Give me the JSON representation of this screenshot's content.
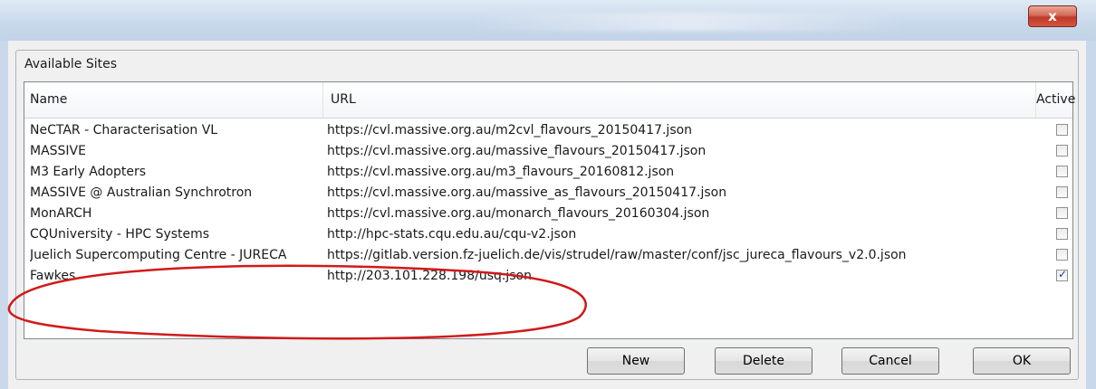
{
  "window": {
    "close_glyph": "x"
  },
  "group": {
    "title": "Available Sites"
  },
  "table": {
    "columns": [
      "Name",
      "URL",
      "Active"
    ],
    "rows": [
      {
        "name": "NeCTAR - Characterisation VL",
        "url": "https://cvl.massive.org.au/m2cvl_flavours_20150417.json",
        "active": false
      },
      {
        "name": "MASSIVE",
        "url": "https://cvl.massive.org.au/massive_flavours_20150417.json",
        "active": false
      },
      {
        "name": "M3 Early Adopters",
        "url": "https://cvl.massive.org.au/m3_flavours_20160812.json",
        "active": false
      },
      {
        "name": "MASSIVE @ Australian Synchrotron",
        "url": "https://cvl.massive.org.au/massive_as_flavours_20150417.json",
        "active": false
      },
      {
        "name": "MonARCH",
        "url": "https://cvl.massive.org.au/monarch_flavours_20160304.json",
        "active": false
      },
      {
        "name": "CQUniversity - HPC Systems",
        "url": "http://hpc-stats.cqu.edu.au/cqu-v2.json",
        "active": false
      },
      {
        "name": "Juelich Supercomputing Centre - JURECA",
        "url": "https://gitlab.version.fz-juelich.de/vis/strudel/raw/master/conf/jsc_jureca_flavours_v2.0.json",
        "active": false
      },
      {
        "name": "Fawkes",
        "url": "http://203.101.228.198/usq.json",
        "active": true
      }
    ]
  },
  "buttons": {
    "new": "New",
    "delete": "Delete",
    "cancel": "Cancel",
    "ok": "OK"
  },
  "colors": {
    "annotation": "#d01a1a",
    "close_button": "#c0392b"
  }
}
